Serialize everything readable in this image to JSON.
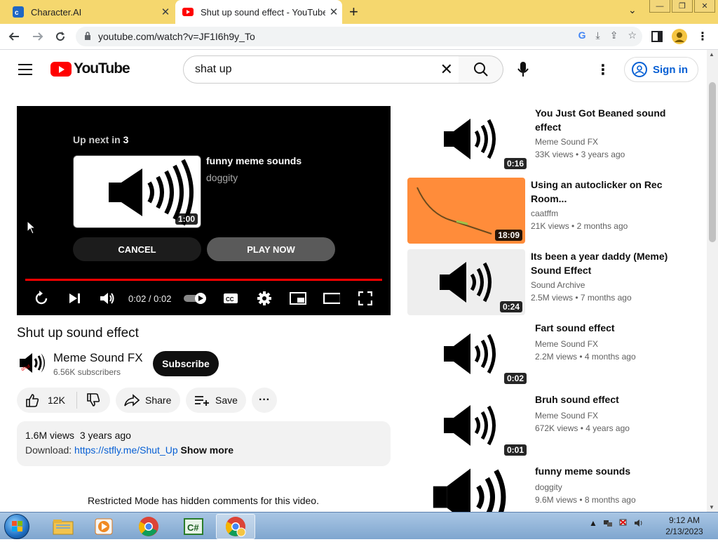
{
  "browser": {
    "tabs": [
      {
        "title": "Character.AI",
        "active": false
      },
      {
        "title": "Shut up sound effect - YouTube",
        "active": true
      }
    ],
    "url": "youtube.com/watch?v=JF1I6h9y_To"
  },
  "youtube": {
    "logo_text": "YouTube",
    "search": {
      "value": "shat up"
    },
    "signin_label": "Sign in"
  },
  "player": {
    "upnext_label": "Up next in",
    "upnext_count": "3",
    "upnext_title": "funny meme sounds",
    "upnext_channel": "doggity",
    "upnext_duration": "1:00",
    "cancel_label": "CANCEL",
    "playnow_label": "PLAY NOW",
    "time": "0:02 / 0:02",
    "progress": 1.0
  },
  "video": {
    "title": "Shut up sound effect",
    "channel": "Meme Sound FX",
    "subscribers": "6.56K subscribers",
    "subscribe_label": "Subscribe",
    "likes": "12K",
    "share_label": "Share",
    "save_label": "Save",
    "views": "1.6M views",
    "age": "3 years ago",
    "download_label": "Download:",
    "download_link": "https://stfly.me/Shut_Up",
    "show_more": "Show more",
    "restricted": "Restricted Mode has hidden comments for this video."
  },
  "recommendations": [
    {
      "title": "You Just Got Beaned sound effect",
      "channel": "Meme Sound FX",
      "views": "33K views",
      "age": "3 years ago",
      "duration": "0:16",
      "thumb": "speaker"
    },
    {
      "title": "Using an autoclicker on Rec Room...",
      "channel": "caatffm",
      "views": "21K views",
      "age": "2 months ago",
      "duration": "18:09",
      "thumb": "orange"
    },
    {
      "title": "Its been a year daddy (Meme) Sound Effect",
      "channel": "Sound Archive",
      "views": "2.5M views",
      "age": "7 months ago",
      "duration": "0:24",
      "thumb": "speaker-gray"
    },
    {
      "title": "Fart sound effect",
      "channel": "Meme Sound FX",
      "views": "2.2M views",
      "age": "4 months ago",
      "duration": "0:02",
      "thumb": "speaker"
    },
    {
      "title": "Bruh sound effect",
      "channel": "Meme Sound FX",
      "views": "672K views",
      "age": "4 years ago",
      "duration": "0:01",
      "thumb": "speaker"
    },
    {
      "title": "funny meme sounds",
      "channel": "doggity",
      "views": "9.6M views",
      "age": "8 months ago",
      "duration": "",
      "thumb": "speaker-big"
    }
  ],
  "taskbar": {
    "clock_time": "9:12 AM",
    "clock_date": "2/13/2023"
  }
}
